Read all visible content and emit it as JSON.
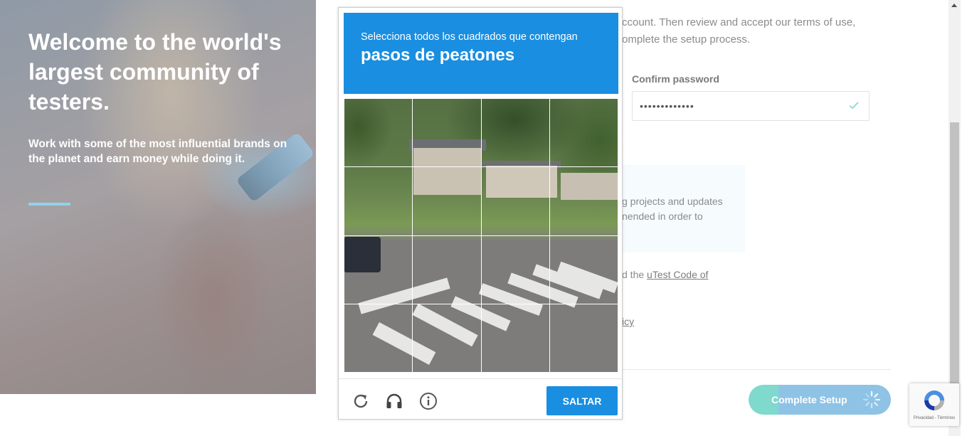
{
  "hero": {
    "title": "Welcome to the world's largest community of testers.",
    "subtitle": "Work with some of the most influential brands on the planet and earn money while doing it."
  },
  "form": {
    "intro_text": "ccount. Then review and accept our terms of use, omplete the setup process.",
    "confirm_password_label": "Confirm password",
    "confirm_password_value": "•••••••••••••",
    "notice_text": "g projects and updates nended in order to",
    "terms_prefix": "d the ",
    "terms_link": "uTest Code of",
    "policy_link": "icy",
    "complete_setup_label": "Complete Setup"
  },
  "captcha": {
    "instruction": "Selecciona todos los cuadrados que contengan",
    "target": "pasos de peatones",
    "skip_label": "SALTAR",
    "icons": [
      "reload-icon",
      "audio-headphones-icon",
      "info-icon"
    ]
  },
  "recaptcha_badge": {
    "legal": "Privacidad - Términos"
  },
  "colors": {
    "captcha_blue": "#1a8ee1",
    "setup_teal": "#7fd9cd",
    "setup_blue": "#8ec3e6",
    "hero_rule": "#8fd3ec"
  }
}
